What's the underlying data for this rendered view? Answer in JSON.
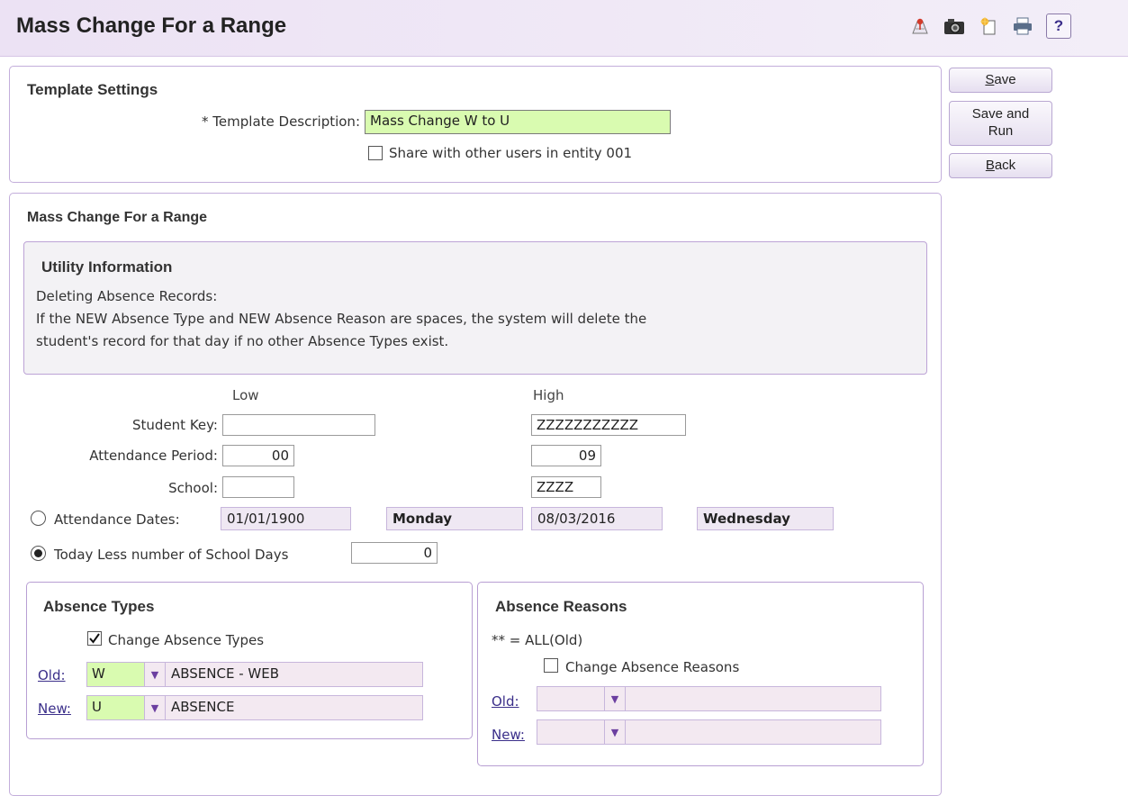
{
  "header": {
    "title": "Mass Change For a Range"
  },
  "toolbar": {
    "icons": [
      "map-pin-icon",
      "camera-icon",
      "new-page-icon",
      "print-icon",
      "help-icon"
    ],
    "help_label": "?"
  },
  "actions": {
    "save_label_u": "S",
    "save_label_rest": "ave",
    "save_run_label_line1": "Save and",
    "save_run_label_line2": "Run",
    "back_label_u": "B",
    "back_label_rest": "ack"
  },
  "template_settings": {
    "heading": "Template Settings",
    "description_label": "* Template Description:",
    "description_value": "Mass Change W to U",
    "share_label": "Share with other users in entity 001",
    "share_checked": false
  },
  "main": {
    "heading": "Mass Change For a Range",
    "utility": {
      "heading": "Utility Information",
      "line1": "Deleting Absence Records:",
      "line2": "If the NEW Absence Type and NEW Absence Reason are spaces, the system will delete the",
      "line3": "student's record for that day if no other Absence Types exist."
    },
    "range": {
      "low_header": "Low",
      "high_header": "High",
      "student_key_label": "Student Key:",
      "student_key_low": "",
      "student_key_high": "ZZZZZZZZZZZ",
      "attendance_period_label": "Attendance Period:",
      "attendance_period_low": "00",
      "attendance_period_high": "09",
      "school_label": "School:",
      "school_low": "",
      "school_high": "ZZZZ",
      "attendance_dates_label": "Attendance Dates:",
      "date_low": "01/01/1900",
      "day_low": "Monday",
      "date_high": "08/03/2016",
      "day_high": "Wednesday",
      "today_less_label": "Today Less number of School Days",
      "today_less_value": "0",
      "selected_option": "Today Less number of School Days"
    },
    "absence_types": {
      "heading": "Absence Types",
      "change_label": "Change Absence Types",
      "change_checked": true,
      "old_label": "Old:",
      "old_code": "W",
      "old_desc": "ABSENCE - WEB",
      "new_label": "New:",
      "new_code": "U",
      "new_desc": "ABSENCE"
    },
    "absence_reasons": {
      "heading": "Absence Reasons",
      "all_note": "** = ALL(Old)",
      "change_label": "Change Absence Reasons",
      "change_checked": false,
      "old_label": "Old:",
      "old_code": "",
      "old_desc": "",
      "new_label": "New:",
      "new_code": "",
      "new_desc": ""
    }
  }
}
